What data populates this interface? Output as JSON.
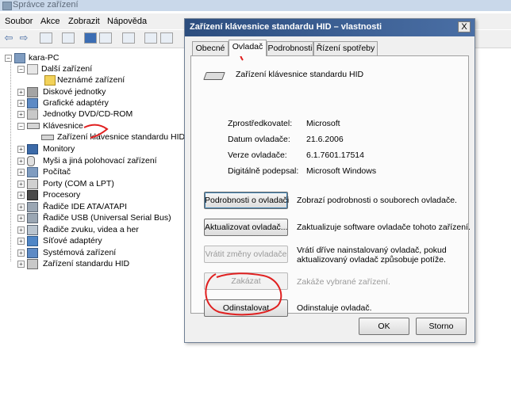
{
  "device_manager": {
    "title": "Správce zařízení",
    "menu": [
      "Soubor",
      "Akce",
      "Zobrazit",
      "Nápověda"
    ],
    "tree": {
      "root": "kara-PC",
      "items": [
        {
          "label": "Další zařízení",
          "level": 1,
          "expanded": true,
          "icon": "question-device-icon"
        },
        {
          "label": "Neznámé zařízení",
          "level": 2,
          "icon": "warning-device-icon"
        },
        {
          "label": "Diskové jednotky",
          "level": 1,
          "icon": "disk-icon"
        },
        {
          "label": "Grafické adaptéry",
          "level": 1,
          "icon": "display-adapter-icon"
        },
        {
          "label": "Jednotky DVD/CD-ROM",
          "level": 1,
          "icon": "dvd-icon"
        },
        {
          "label": "Klávesnice",
          "level": 1,
          "expanded": true,
          "icon": "keyboard-icon"
        },
        {
          "label": "Zařízení klávesnice standardu HID",
          "level": 2,
          "icon": "keyboard-icon"
        },
        {
          "label": "Monitory",
          "level": 1,
          "icon": "monitor-icon"
        },
        {
          "label": "Myši a jiná polohovací zařízení",
          "level": 1,
          "icon": "mouse-icon"
        },
        {
          "label": "Počítač",
          "level": 1,
          "icon": "computer-icon"
        },
        {
          "label": "Porty (COM a LPT)",
          "level": 1,
          "icon": "port-icon"
        },
        {
          "label": "Procesory",
          "level": 1,
          "icon": "processor-icon"
        },
        {
          "label": "Řadiče IDE ATA/ATAPI",
          "level": 1,
          "icon": "ide-controller-icon"
        },
        {
          "label": "Řadiče USB (Universal Serial Bus)",
          "level": 1,
          "icon": "usb-icon"
        },
        {
          "label": "Řadiče zvuku, videa a her",
          "level": 1,
          "icon": "sound-icon"
        },
        {
          "label": "Síťové adaptéry",
          "level": 1,
          "icon": "network-icon"
        },
        {
          "label": "Systémová zařízení",
          "level": 1,
          "icon": "system-device-icon"
        },
        {
          "label": "Zařízení standardu HID",
          "level": 1,
          "icon": "hid-icon"
        }
      ]
    }
  },
  "dialog": {
    "title": "Zařízení klávesnice standardu HID – vlastnosti",
    "close": "X",
    "tabs": [
      "Obecné",
      "Ovladač",
      "Podrobnosti",
      "Řízení spotřeby"
    ],
    "active_tab": "Ovladač",
    "device_name": "Zařízení klávesnice standardu HID",
    "props": [
      {
        "label": "Zprostředkovatel:",
        "value": "Microsoft"
      },
      {
        "label": "Datum ovladače:",
        "value": "21.6.2006"
      },
      {
        "label": "Verze ovladače:",
        "value": "6.1.7601.17514"
      },
      {
        "label": "Digitálně podepsal:",
        "value": "Microsoft Windows"
      }
    ],
    "actions": [
      {
        "button": "Podrobnosti o ovladači",
        "desc": "Zobrazí podrobnosti o souborech ovladače.",
        "enabled": true
      },
      {
        "button": "Aktualizovat ovladač...",
        "desc": "Zaktualizuje software ovladače tohoto zařízení.",
        "enabled": true
      },
      {
        "button": "Vrátit změny ovladače",
        "desc": "Vrátí dříve nainstalovaný ovladač, pokud\naktualizovaný ovladač způsobuje potíže.",
        "enabled": false
      },
      {
        "button": "Zakázat",
        "desc": "Zakáže vybrané zařízení.",
        "enabled": false
      },
      {
        "button": "Odinstalovat",
        "desc": "Odinstaluje ovladač.",
        "enabled": true
      }
    ],
    "ok": "OK",
    "cancel": "Storno"
  },
  "colors": {
    "dialog_title": "#2c4d7e",
    "annotation": "#e02020"
  }
}
